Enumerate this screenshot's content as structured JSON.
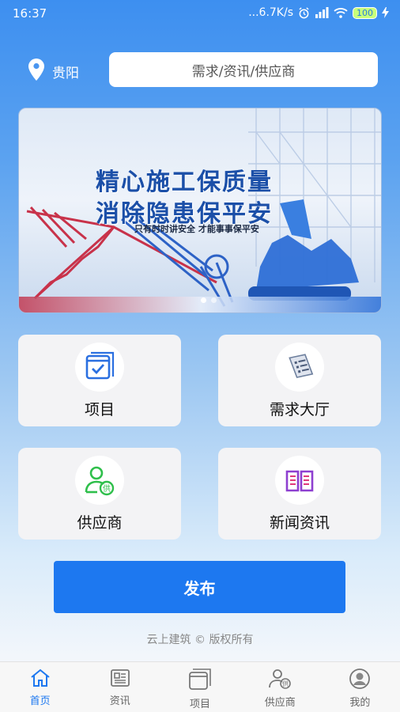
{
  "status_bar": {
    "time": "16:37",
    "network_speed": "...6.7K/s",
    "battery_level": "100"
  },
  "header": {
    "location": "贵阳",
    "search_placeholder": "需求/资讯/供应商"
  },
  "banner": {
    "line1": "精心施工保质量",
    "line2": "消除隐患保平安",
    "subtitle": "只有时时讲安全  才能事事保平安",
    "slide_count": 2,
    "active_slide": 0
  },
  "grid": [
    {
      "label": "项目",
      "icon": "project-icon"
    },
    {
      "label": "需求大厅",
      "icon": "demand-hall-icon"
    },
    {
      "label": "供应商",
      "icon": "supplier-icon"
    },
    {
      "label": "新闻资讯",
      "icon": "news-icon"
    }
  ],
  "publish_label": "发布",
  "copyright": "云上建筑 © 版权所有",
  "tabbar": [
    {
      "label": "首页",
      "icon": "home-icon",
      "active": true
    },
    {
      "label": "资讯",
      "icon": "news-tab-icon",
      "active": false
    },
    {
      "label": "项目",
      "icon": "project-tab-icon",
      "active": false
    },
    {
      "label": "供应商",
      "icon": "supplier-tab-icon",
      "active": false
    },
    {
      "label": "我的",
      "icon": "profile-icon",
      "active": false
    }
  ],
  "colors": {
    "primary": "#1d78f0",
    "background_top": "#3d8ff0",
    "card_bg": "#f3f3f5"
  }
}
